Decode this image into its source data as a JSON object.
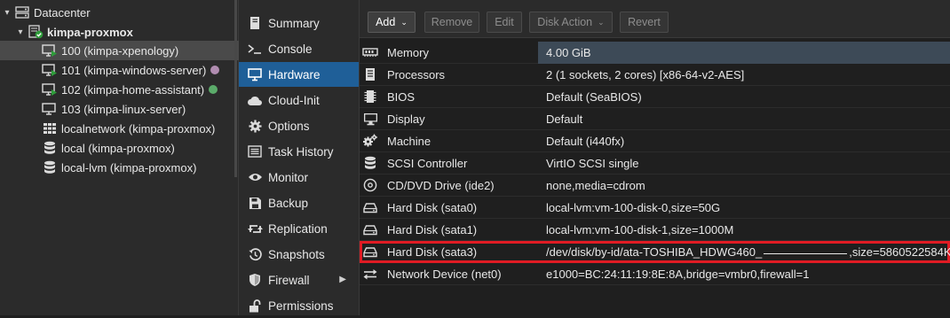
{
  "tree": {
    "datacenter": "Datacenter",
    "node": "kimpa-proxmox",
    "items": [
      {
        "label": "100 (kimpa-xpenology)",
        "icon": "vm-running-icon",
        "selected": true,
        "tag_color": ""
      },
      {
        "label": "101 (kimpa-windows-server)",
        "icon": "vm-running-icon",
        "selected": false,
        "tag_color": "#b08cb0"
      },
      {
        "label": "102 (kimpa-home-assistant)",
        "icon": "vm-running-icon",
        "selected": false,
        "tag_color": "#5bab6a"
      },
      {
        "label": "103 (kimpa-linux-server)",
        "icon": "vm-stopped-icon",
        "selected": false,
        "tag_color": ""
      },
      {
        "label": "localnetwork (kimpa-proxmox)",
        "icon": "sdn-grid-icon",
        "selected": false,
        "tag_color": ""
      },
      {
        "label": "local (kimpa-proxmox)",
        "icon": "storage-icon",
        "selected": false,
        "tag_color": ""
      },
      {
        "label": "local-lvm (kimpa-proxmox)",
        "icon": "storage-icon",
        "selected": false,
        "tag_color": ""
      }
    ]
  },
  "nav": {
    "items": [
      {
        "label": "Summary",
        "icon": "book-icon"
      },
      {
        "label": "Console",
        "icon": "terminal-icon"
      },
      {
        "label": "Hardware",
        "icon": "monitor-icon",
        "active": true
      },
      {
        "label": "Cloud-Init",
        "icon": "cloud-icon"
      },
      {
        "label": "Options",
        "icon": "gear-icon"
      },
      {
        "label": "Task History",
        "icon": "list-icon"
      },
      {
        "label": "Monitor",
        "icon": "eye-icon"
      },
      {
        "label": "Backup",
        "icon": "save-icon"
      },
      {
        "label": "Replication",
        "icon": "retweet-icon"
      },
      {
        "label": "Snapshots",
        "icon": "history-icon"
      },
      {
        "label": "Firewall",
        "icon": "shield-icon",
        "has_submenu": true
      },
      {
        "label": "Permissions",
        "icon": "unlock-icon"
      }
    ]
  },
  "toolbar": {
    "add": "Add",
    "remove": "Remove",
    "edit": "Edit",
    "disk_action": "Disk Action",
    "revert": "Revert"
  },
  "hardware": [
    {
      "name": "Memory",
      "value": "4.00 GiB",
      "icon": "memory-icon",
      "selected": true
    },
    {
      "name": "Processors",
      "value": "2 (1 sockets, 2 cores) [x86-64-v2-AES]",
      "icon": "cpu-icon"
    },
    {
      "name": "BIOS",
      "value": "Default (SeaBIOS)",
      "icon": "microchip-icon"
    },
    {
      "name": "Display",
      "value": "Default",
      "icon": "desktop-icon"
    },
    {
      "name": "Machine",
      "value": "Default (i440fx)",
      "icon": "cogs-icon"
    },
    {
      "name": "SCSI Controller",
      "value": "VirtIO SCSI single",
      "icon": "database-icon"
    },
    {
      "name": "CD/DVD Drive (ide2)",
      "value": "none,media=cdrom",
      "icon": "cdrom-icon"
    },
    {
      "name": "Hard Disk (sata0)",
      "value": "local-lvm:vm-100-disk-0,size=50G",
      "icon": "hdd-icon"
    },
    {
      "name": "Hard Disk (sata1)",
      "value": "local-lvm:vm-100-disk-1,size=1000M",
      "icon": "hdd-icon"
    },
    {
      "name": "Hard Disk (sata3)",
      "value_prefix": "/dev/disk/by-id/ata-TOSHIBA_HDWG460_",
      "value_suffix": ",size=5860522584K",
      "icon": "hdd-icon",
      "highlighted": true,
      "highlight_color": "#e01b24"
    },
    {
      "name": "Network Device (net0)",
      "value": "e1000=BC:24:11:19:8E:8A,bridge=vmbr0,firewall=1",
      "icon": "network-icon"
    }
  ]
}
